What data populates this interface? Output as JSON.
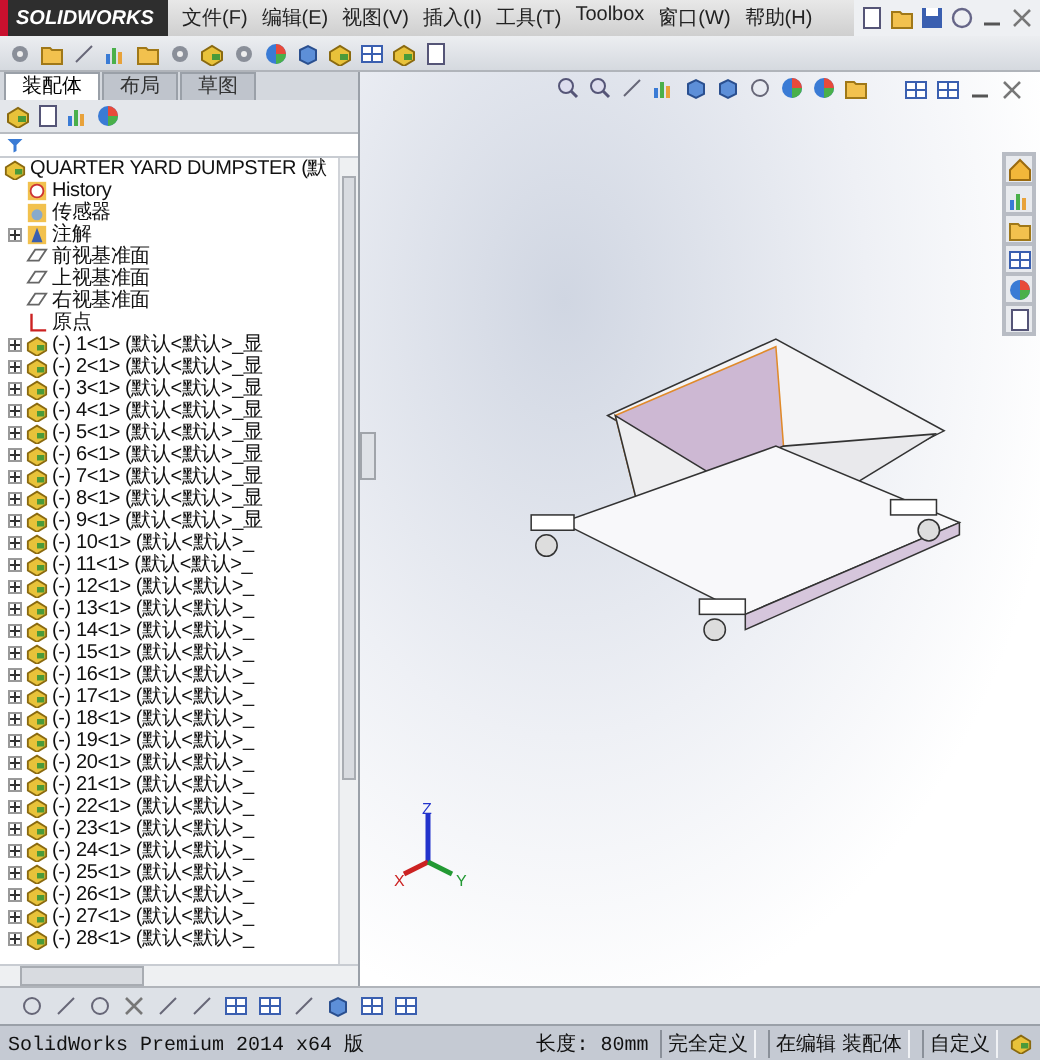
{
  "app": {
    "logo": "SOLIDWORKS"
  },
  "menu": [
    "文件(F)",
    "编辑(E)",
    "视图(V)",
    "插入(I)",
    "工具(T)",
    "Toolbox",
    "窗口(W)",
    "帮助(H)"
  ],
  "tree_tabs": [
    {
      "label": "装配体",
      "selected": true
    },
    {
      "label": "布局",
      "selected": false
    },
    {
      "label": "草图",
      "selected": false
    }
  ],
  "tree": {
    "label": "QUARTER YARD DUMPSTER (默",
    "children": [
      {
        "kind": "history",
        "label": "History",
        "expandable": false
      },
      {
        "kind": "sensor",
        "label": "传感器",
        "expandable": false
      },
      {
        "kind": "annotation",
        "label": "注解",
        "expandable": true
      },
      {
        "kind": "plane",
        "label": "前视基准面",
        "expandable": false
      },
      {
        "kind": "plane",
        "label": "上视基准面",
        "expandable": false
      },
      {
        "kind": "plane",
        "label": "右视基准面",
        "expandable": false
      },
      {
        "kind": "origin",
        "label": "原点",
        "expandable": false
      },
      {
        "kind": "component",
        "label": "(-) 1<1> (默认<默认>_显",
        "expandable": true
      },
      {
        "kind": "component",
        "label": "(-) 2<1> (默认<默认>_显",
        "expandable": true
      },
      {
        "kind": "component",
        "label": "(-) 3<1> (默认<默认>_显",
        "expandable": true
      },
      {
        "kind": "component",
        "label": "(-) 4<1> (默认<默认>_显",
        "expandable": true
      },
      {
        "kind": "component",
        "label": "(-) 5<1> (默认<默认>_显",
        "expandable": true
      },
      {
        "kind": "component",
        "label": "(-) 6<1> (默认<默认>_显",
        "expandable": true
      },
      {
        "kind": "component",
        "label": "(-) 7<1> (默认<默认>_显",
        "expandable": true
      },
      {
        "kind": "component",
        "label": "(-) 8<1> (默认<默认>_显",
        "expandable": true
      },
      {
        "kind": "component",
        "label": "(-) 9<1> (默认<默认>_显",
        "expandable": true
      },
      {
        "kind": "component",
        "label": "(-) 10<1> (默认<默认>_",
        "expandable": true
      },
      {
        "kind": "component",
        "label": "(-) 11<1> (默认<默认>_",
        "expandable": true
      },
      {
        "kind": "component",
        "label": "(-) 12<1> (默认<默认>_",
        "expandable": true
      },
      {
        "kind": "component",
        "label": "(-) 13<1> (默认<默认>_",
        "expandable": true
      },
      {
        "kind": "component",
        "label": "(-) 14<1> (默认<默认>_",
        "expandable": true
      },
      {
        "kind": "component",
        "label": "(-) 15<1> (默认<默认>_",
        "expandable": true
      },
      {
        "kind": "component",
        "label": "(-) 16<1> (默认<默认>_",
        "expandable": true
      },
      {
        "kind": "component",
        "label": "(-) 17<1> (默认<默认>_",
        "expandable": true
      },
      {
        "kind": "component",
        "label": "(-) 18<1> (默认<默认>_",
        "expandable": true
      },
      {
        "kind": "component",
        "label": "(-) 19<1> (默认<默认>_",
        "expandable": true
      },
      {
        "kind": "component",
        "label": "(-) 20<1> (默认<默认>_",
        "expandable": true
      },
      {
        "kind": "component",
        "label": "(-) 21<1> (默认<默认>_",
        "expandable": true
      },
      {
        "kind": "component",
        "label": "(-) 22<1> (默认<默认>_",
        "expandable": true
      },
      {
        "kind": "component",
        "label": "(-) 23<1> (默认<默认>_",
        "expandable": true
      },
      {
        "kind": "component",
        "label": "(-) 24<1> (默认<默认>_",
        "expandable": true
      },
      {
        "kind": "component",
        "label": "(-) 25<1> (默认<默认>_",
        "expandable": true
      },
      {
        "kind": "component",
        "label": "(-) 26<1> (默认<默认>_",
        "expandable": true
      },
      {
        "kind": "component",
        "label": "(-) 27<1> (默认<默认>_",
        "expandable": true
      },
      {
        "kind": "component",
        "label": "(-) 28<1> (默认<默认>_",
        "expandable": true
      }
    ]
  },
  "triad": [
    "X",
    "Y",
    "Z"
  ],
  "status_bar": {
    "product": "SolidWorks Premium 2014 x64 版",
    "length": "长度: 80mm",
    "definition": "完全定义",
    "mode": "在编辑 装配体",
    "units": "自定义"
  }
}
